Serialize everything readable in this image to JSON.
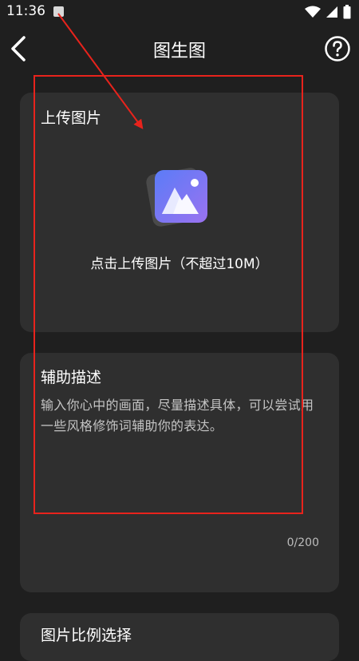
{
  "status_bar": {
    "time": "11:36"
  },
  "header": {
    "title": "图生图"
  },
  "upload_card": {
    "title": "上传图片",
    "hint": "点击上传图片（不超过10M）"
  },
  "description_card": {
    "title": "辅助描述",
    "placeholder": "输入你心中的画面，尽量描述具体，可以尝试用一些风格修饰词辅助你的表达。",
    "counter": "0/200"
  },
  "ratio_card": {
    "title": "图片比例选择"
  },
  "colors": {
    "background": "#1f1f1f",
    "card": "#2f2f2f",
    "annotation": "#e8231c",
    "icon_gradient_start": "#5b7cf7",
    "icon_gradient_end": "#9a72f0"
  },
  "icons": [
    "notification-icon",
    "wifi-icon",
    "cellular-signal-icon",
    "battery-icon",
    "back-arrow-icon",
    "help-icon",
    "image-upload-icon"
  ]
}
